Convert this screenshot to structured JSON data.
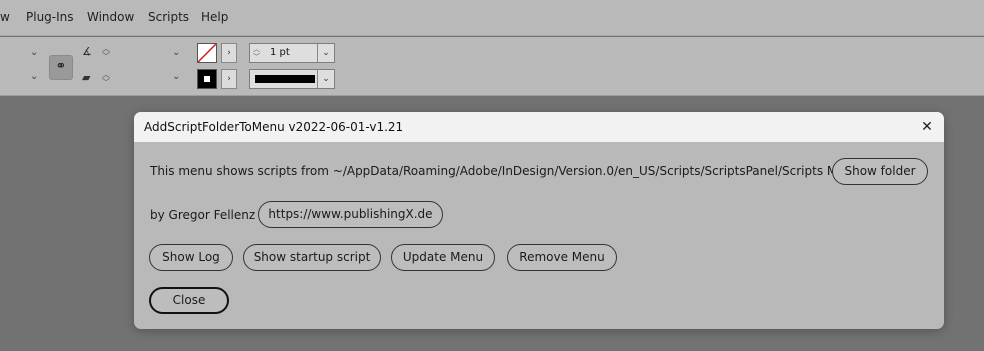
{
  "menubar": {
    "items": [
      "w",
      "Plug-Ins",
      "Window",
      "Scripts",
      "Help"
    ]
  },
  "controlbar": {
    "stroke_weight": "1 pt",
    "icons": {
      "link": "link-icon",
      "angle": "rotate-angle-icon",
      "shear": "shear-icon",
      "fill": "fill-swatch-icon",
      "stroke": "stroke-swatch-icon"
    }
  },
  "dialog": {
    "title": "AddScriptFolderToMenu v2022-06-01-v1.21",
    "close_glyph": "✕",
    "info_text": "This menu shows scripts from ~/AppData/Roaming/Adobe/InDesign/Version.0/en_US/Scripts/ScriptsPanel/Scripts Menu",
    "show_folder_label": "Show folder",
    "author_text": "by Gregor Fellenz",
    "website_label": "https://www.publishingX.de",
    "buttons": {
      "show_log": "Show Log",
      "show_startup": "Show startup script",
      "update_menu": "Update Menu",
      "remove_menu": "Remove Menu",
      "close": "Close"
    }
  }
}
